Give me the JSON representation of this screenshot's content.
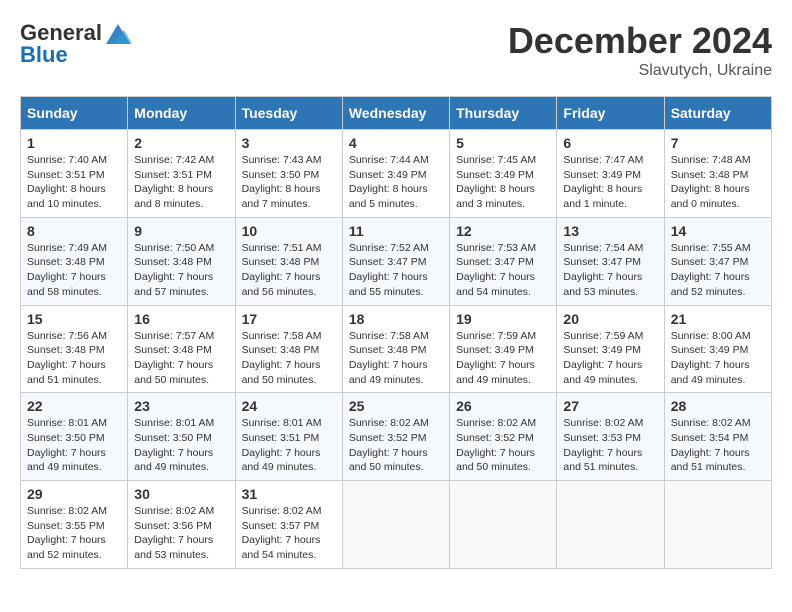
{
  "logo": {
    "general": "General",
    "blue": "Blue"
  },
  "header": {
    "month": "December 2024",
    "location": "Slavutych, Ukraine"
  },
  "weekdays": [
    "Sunday",
    "Monday",
    "Tuesday",
    "Wednesday",
    "Thursday",
    "Friday",
    "Saturday"
  ],
  "weeks": [
    [
      {
        "day": "1",
        "sunrise": "Sunrise: 7:40 AM",
        "sunset": "Sunset: 3:51 PM",
        "daylight": "Daylight: 8 hours and 10 minutes."
      },
      {
        "day": "2",
        "sunrise": "Sunrise: 7:42 AM",
        "sunset": "Sunset: 3:51 PM",
        "daylight": "Daylight: 8 hours and 8 minutes."
      },
      {
        "day": "3",
        "sunrise": "Sunrise: 7:43 AM",
        "sunset": "Sunset: 3:50 PM",
        "daylight": "Daylight: 8 hours and 7 minutes."
      },
      {
        "day": "4",
        "sunrise": "Sunrise: 7:44 AM",
        "sunset": "Sunset: 3:49 PM",
        "daylight": "Daylight: 8 hours and 5 minutes."
      },
      {
        "day": "5",
        "sunrise": "Sunrise: 7:45 AM",
        "sunset": "Sunset: 3:49 PM",
        "daylight": "Daylight: 8 hours and 3 minutes."
      },
      {
        "day": "6",
        "sunrise": "Sunrise: 7:47 AM",
        "sunset": "Sunset: 3:49 PM",
        "daylight": "Daylight: 8 hours and 1 minute."
      },
      {
        "day": "7",
        "sunrise": "Sunrise: 7:48 AM",
        "sunset": "Sunset: 3:48 PM",
        "daylight": "Daylight: 8 hours and 0 minutes."
      }
    ],
    [
      {
        "day": "8",
        "sunrise": "Sunrise: 7:49 AM",
        "sunset": "Sunset: 3:48 PM",
        "daylight": "Daylight: 7 hours and 58 minutes."
      },
      {
        "day": "9",
        "sunrise": "Sunrise: 7:50 AM",
        "sunset": "Sunset: 3:48 PM",
        "daylight": "Daylight: 7 hours and 57 minutes."
      },
      {
        "day": "10",
        "sunrise": "Sunrise: 7:51 AM",
        "sunset": "Sunset: 3:48 PM",
        "daylight": "Daylight: 7 hours and 56 minutes."
      },
      {
        "day": "11",
        "sunrise": "Sunrise: 7:52 AM",
        "sunset": "Sunset: 3:47 PM",
        "daylight": "Daylight: 7 hours and 55 minutes."
      },
      {
        "day": "12",
        "sunrise": "Sunrise: 7:53 AM",
        "sunset": "Sunset: 3:47 PM",
        "daylight": "Daylight: 7 hours and 54 minutes."
      },
      {
        "day": "13",
        "sunrise": "Sunrise: 7:54 AM",
        "sunset": "Sunset: 3:47 PM",
        "daylight": "Daylight: 7 hours and 53 minutes."
      },
      {
        "day": "14",
        "sunrise": "Sunrise: 7:55 AM",
        "sunset": "Sunset: 3:47 PM",
        "daylight": "Daylight: 7 hours and 52 minutes."
      }
    ],
    [
      {
        "day": "15",
        "sunrise": "Sunrise: 7:56 AM",
        "sunset": "Sunset: 3:48 PM",
        "daylight": "Daylight: 7 hours and 51 minutes."
      },
      {
        "day": "16",
        "sunrise": "Sunrise: 7:57 AM",
        "sunset": "Sunset: 3:48 PM",
        "daylight": "Daylight: 7 hours and 50 minutes."
      },
      {
        "day": "17",
        "sunrise": "Sunrise: 7:58 AM",
        "sunset": "Sunset: 3:48 PM",
        "daylight": "Daylight: 7 hours and 50 minutes."
      },
      {
        "day": "18",
        "sunrise": "Sunrise: 7:58 AM",
        "sunset": "Sunset: 3:48 PM",
        "daylight": "Daylight: 7 hours and 49 minutes."
      },
      {
        "day": "19",
        "sunrise": "Sunrise: 7:59 AM",
        "sunset": "Sunset: 3:49 PM",
        "daylight": "Daylight: 7 hours and 49 minutes."
      },
      {
        "day": "20",
        "sunrise": "Sunrise: 7:59 AM",
        "sunset": "Sunset: 3:49 PM",
        "daylight": "Daylight: 7 hours and 49 minutes."
      },
      {
        "day": "21",
        "sunrise": "Sunrise: 8:00 AM",
        "sunset": "Sunset: 3:49 PM",
        "daylight": "Daylight: 7 hours and 49 minutes."
      }
    ],
    [
      {
        "day": "22",
        "sunrise": "Sunrise: 8:01 AM",
        "sunset": "Sunset: 3:50 PM",
        "daylight": "Daylight: 7 hours and 49 minutes."
      },
      {
        "day": "23",
        "sunrise": "Sunrise: 8:01 AM",
        "sunset": "Sunset: 3:50 PM",
        "daylight": "Daylight: 7 hours and 49 minutes."
      },
      {
        "day": "24",
        "sunrise": "Sunrise: 8:01 AM",
        "sunset": "Sunset: 3:51 PM",
        "daylight": "Daylight: 7 hours and 49 minutes."
      },
      {
        "day": "25",
        "sunrise": "Sunrise: 8:02 AM",
        "sunset": "Sunset: 3:52 PM",
        "daylight": "Daylight: 7 hours and 50 minutes."
      },
      {
        "day": "26",
        "sunrise": "Sunrise: 8:02 AM",
        "sunset": "Sunset: 3:52 PM",
        "daylight": "Daylight: 7 hours and 50 minutes."
      },
      {
        "day": "27",
        "sunrise": "Sunrise: 8:02 AM",
        "sunset": "Sunset: 3:53 PM",
        "daylight": "Daylight: 7 hours and 51 minutes."
      },
      {
        "day": "28",
        "sunrise": "Sunrise: 8:02 AM",
        "sunset": "Sunset: 3:54 PM",
        "daylight": "Daylight: 7 hours and 51 minutes."
      }
    ],
    [
      {
        "day": "29",
        "sunrise": "Sunrise: 8:02 AM",
        "sunset": "Sunset: 3:55 PM",
        "daylight": "Daylight: 7 hours and 52 minutes."
      },
      {
        "day": "30",
        "sunrise": "Sunrise: 8:02 AM",
        "sunset": "Sunset: 3:56 PM",
        "daylight": "Daylight: 7 hours and 53 minutes."
      },
      {
        "day": "31",
        "sunrise": "Sunrise: 8:02 AM",
        "sunset": "Sunset: 3:57 PM",
        "daylight": "Daylight: 7 hours and 54 minutes."
      },
      null,
      null,
      null,
      null
    ]
  ]
}
